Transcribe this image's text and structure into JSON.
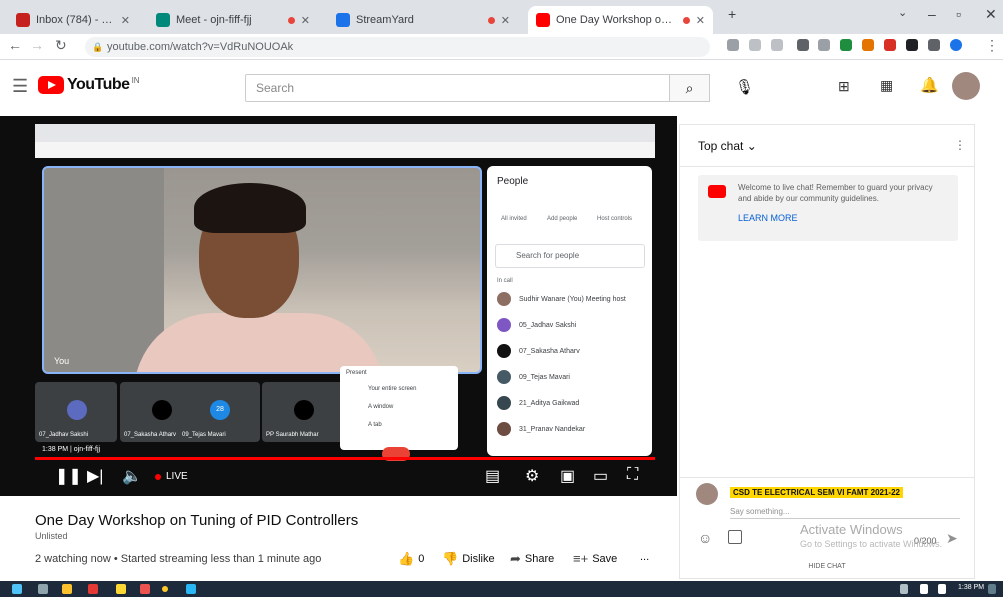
{
  "browser": {
    "tabs": [
      {
        "title": "Inbox (784) - sudhir.wanare@c",
        "color": "#c5221f"
      },
      {
        "title": "Meet - ojn-fiff-fjj",
        "color": "#00897b"
      },
      {
        "title": "StreamYard",
        "color": "#1a73e8"
      },
      {
        "title": "One Day Workshop on Tuni",
        "color": "#ff0000"
      }
    ],
    "url": "youtube.com/watch?v=VdRuNOUOAk",
    "new_tab": "+"
  },
  "youtube": {
    "logo_text": "YouTube",
    "logo_badge": "IN",
    "search_placeholder": "Search"
  },
  "meet": {
    "self_tag": "You",
    "people_title": "People",
    "people_tabs": [
      "All invited",
      "Add people",
      "Host controls"
    ],
    "search_people": "Search for people",
    "in_call": "In call",
    "participants": [
      {
        "name": "Sudhir Wanare (You) Meeting host",
        "color": "#8d6e63"
      },
      {
        "name": "05_Jadhav Sakshi",
        "color": "#7e57c2"
      },
      {
        "name": "07_Sakasha Atharv",
        "color": "#111111"
      },
      {
        "name": "09_Tejas Mavari",
        "color": "#455a64"
      },
      {
        "name": "21_Aditya Gaikwad",
        "color": "#37474f"
      },
      {
        "name": "31_Pranav Nandekar",
        "color": "#6d4c41"
      }
    ],
    "tiles": [
      {
        "name": "07_Jadhav Sakshi",
        "color": "#5c6bc0"
      },
      {
        "name": "07_Sakasha Atharv",
        "color": "#000000"
      },
      {
        "name": "09_Tejas Mavari",
        "color": "#1e88e5",
        "initials": "28"
      },
      {
        "name": "PP Saurabh Mathar",
        "color": "#000000"
      }
    ],
    "present_menu": [
      "Present",
      "Your entire screen",
      "A window",
      "A tab"
    ],
    "meeting_code": "1:38 PM | ojn-fiff-fjj"
  },
  "player": {
    "live_label": "LIVE"
  },
  "video": {
    "title": "One Day Workshop on Tuning of PID Controllers",
    "visibility": "Unlisted",
    "stats": "2 watching now • Started streaming less than 1 minute ago",
    "likes": "0",
    "dislike_label": "Dislike",
    "share_label": "Share",
    "save_label": "Save",
    "more_label": "..."
  },
  "chat": {
    "header": "Top chat",
    "welcome": "Welcome to live chat! Remember to guard your privacy and abide by our community guidelines.",
    "learn_more": "LEARN MORE",
    "channel_name": "CSD TE ELECTRICAL SEM VI FAMT 2021-22",
    "input_placeholder": "Say something...",
    "char_count": "0/200",
    "hide_chat": "HIDE CHAT"
  },
  "watermark": {
    "line1": "Activate Windows",
    "line2": "Go to Settings to activate Windows."
  },
  "taskbar": {
    "clock": "1:38 PM"
  }
}
